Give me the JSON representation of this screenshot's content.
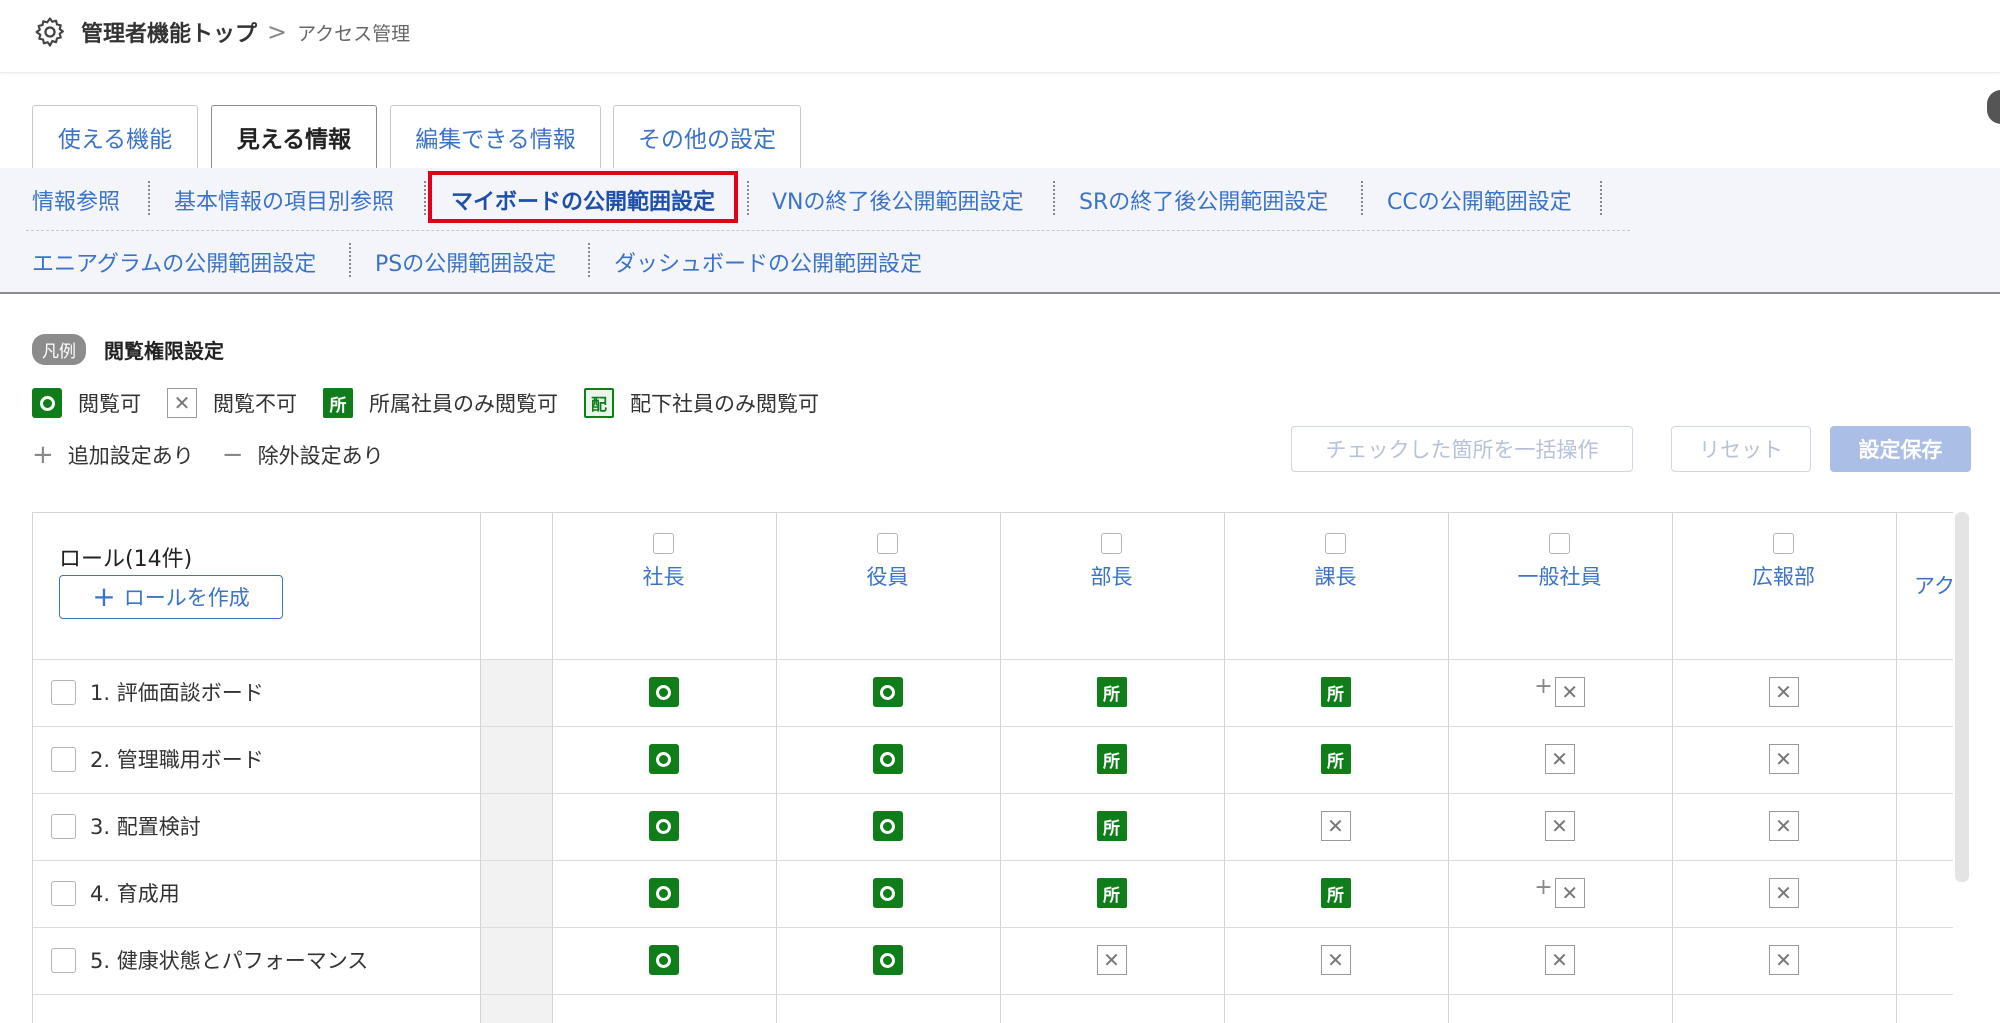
{
  "breadcrumb": {
    "home": "管理者機能トップ",
    "separator": ">",
    "current": "アクセス管理"
  },
  "tabs": [
    "使える機能",
    "見える情報",
    "編集できる情報",
    "その他の設定"
  ],
  "active_tab": "見える情報",
  "subnav": {
    "row1": [
      "情報参照",
      "基本情報の項目別参照",
      "マイボードの公開範囲設定",
      "VNの終了後公開範囲設定",
      "SRの終了後公開範囲設定",
      "CCの公開範囲設定"
    ],
    "row2": [
      "エニアグラムの公開範囲設定",
      "PSの公開範囲設定",
      "ダッシュボードの公開範囲設定"
    ],
    "selected": "マイボードの公開範囲設定"
  },
  "legend": {
    "pill": "凡例",
    "title": "閲覧権限設定",
    "ok_label": "閲覧可",
    "ng_label": "閲覧不可",
    "sho_icon_text": "所",
    "sho_label": "所属社員のみ閲覧可",
    "hai_icon_text": "配",
    "hai_label": "配下社員のみ閲覧可",
    "add_symbol": "+",
    "add_label": "追加設定あり",
    "minus_symbol": "−",
    "minus_label": "除外設定あり"
  },
  "actions": {
    "bulk": "チェックした箇所を一括操作",
    "reset": "リセット",
    "save": "設定保存"
  },
  "table": {
    "roles_title": "ロール(14件)",
    "create_role_plus": "+",
    "create_role": "ロールを作成",
    "columns": [
      "社長",
      "役員",
      "部長",
      "課長",
      "一般社員",
      "広報部",
      "アク"
    ],
    "rows": [
      {
        "label": "1. 評価面談ボード",
        "cells": [
          "ok",
          "ok",
          "sho",
          "sho",
          "ng+",
          "ng"
        ]
      },
      {
        "label": "2. 管理職用ボード",
        "cells": [
          "ok",
          "ok",
          "sho",
          "sho",
          "ng",
          "ng"
        ]
      },
      {
        "label": "3. 配置検討",
        "cells": [
          "ok",
          "ok",
          "sho",
          "ng",
          "ng",
          "ng"
        ]
      },
      {
        "label": "4. 育成用",
        "cells": [
          "ok",
          "ok",
          "sho",
          "sho",
          "ng+",
          "ng"
        ]
      },
      {
        "label": "5. 健康状態とパフォーマンス",
        "cells": [
          "ok",
          "ok",
          "ng",
          "ng",
          "ng",
          "ng"
        ]
      }
    ]
  },
  "icons": {
    "ok": "circle-ok-icon",
    "ng": "x-box-icon",
    "sho": "sho-badge-icon",
    "hai": "hai-badge-icon"
  },
  "colors": {
    "link": "#3b73c8",
    "green": "#0f7d1a",
    "highlight": "#e0001b"
  }
}
